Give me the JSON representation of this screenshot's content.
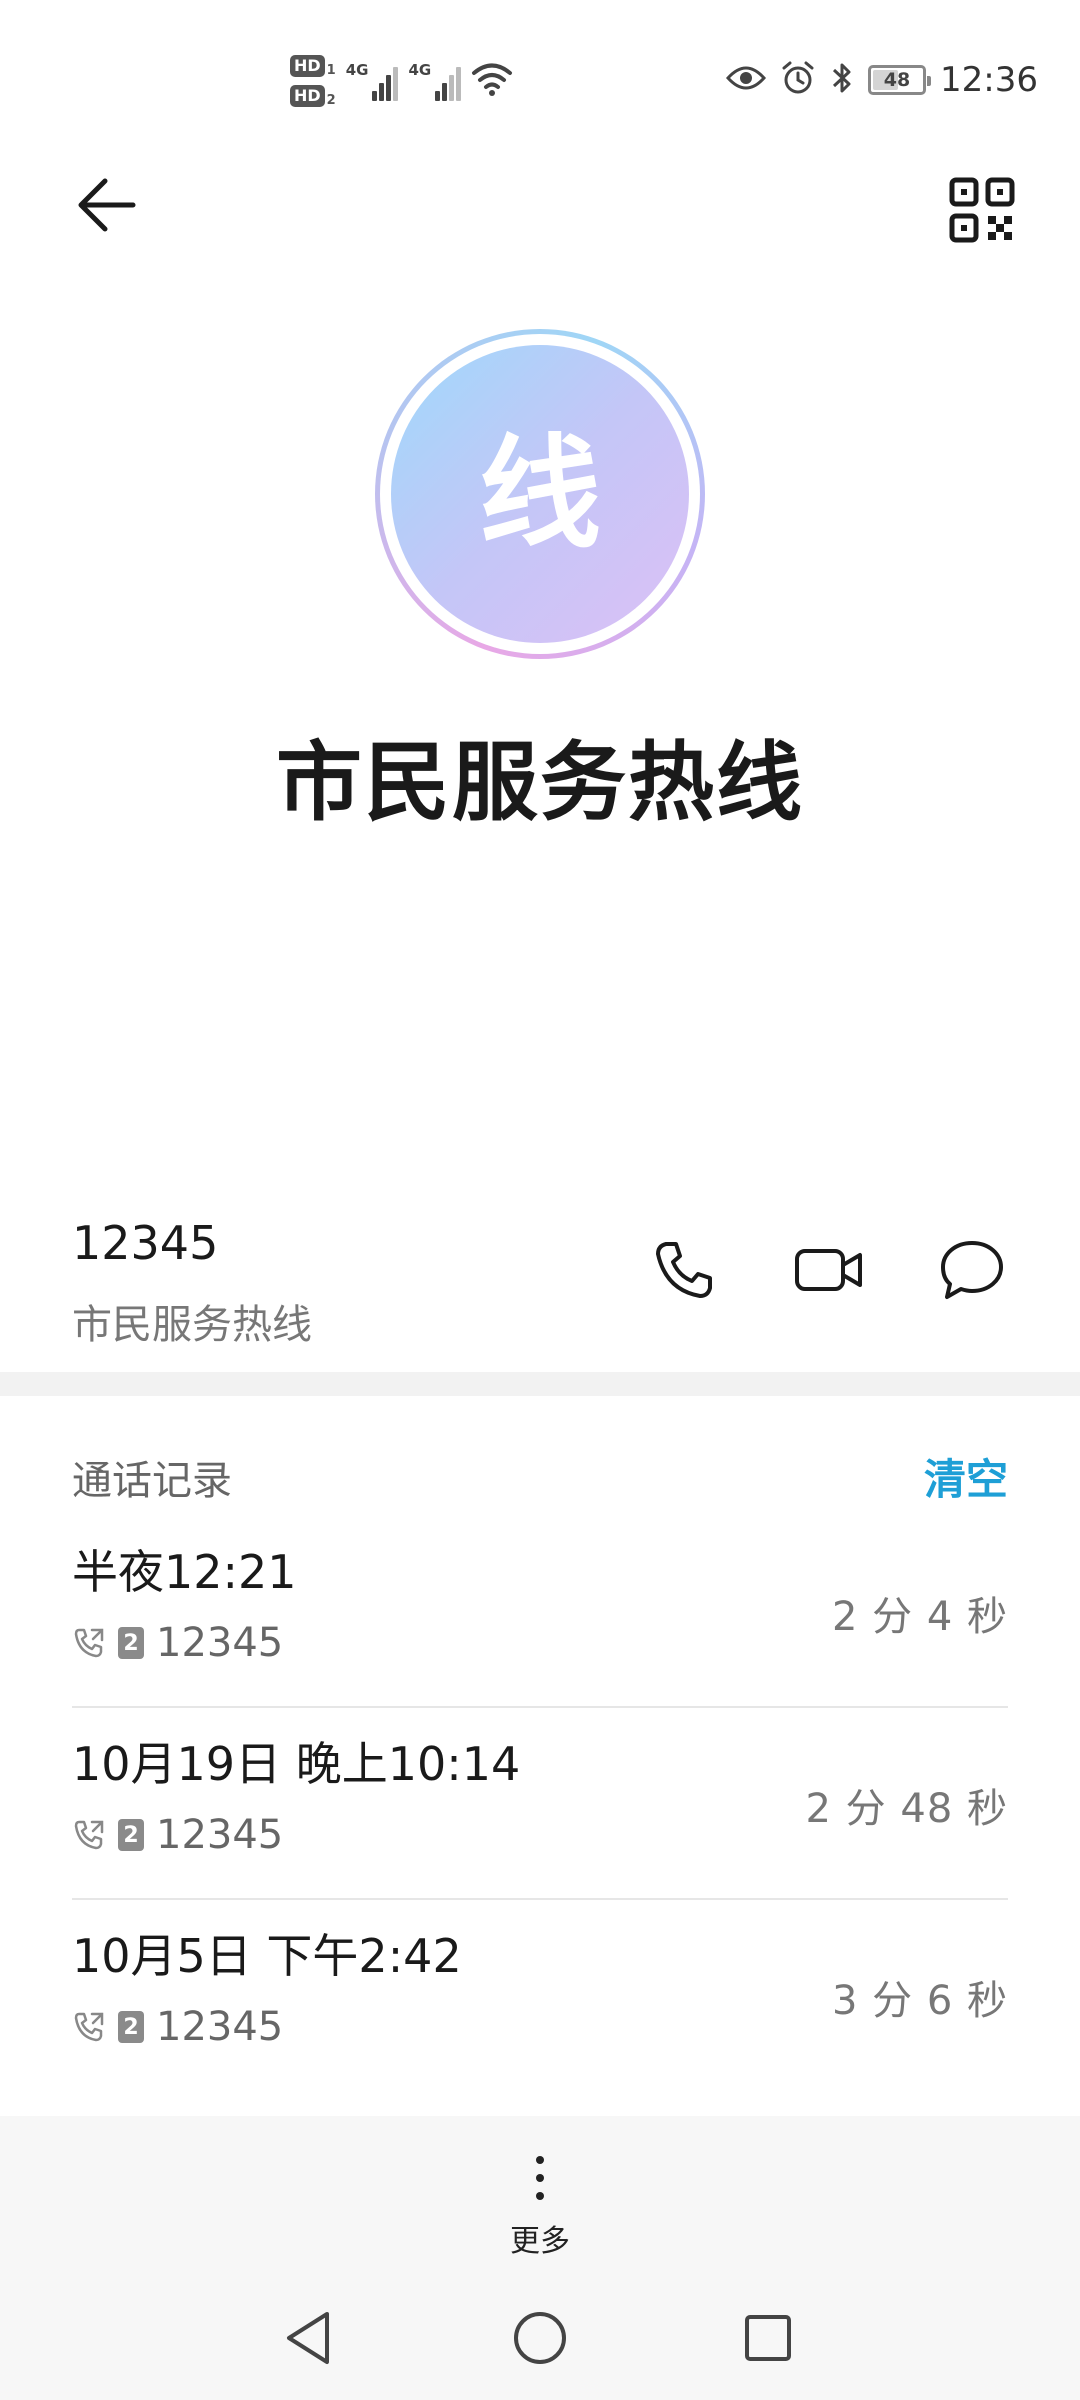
{
  "status_bar": {
    "hd1": "HD",
    "hd1_sub": "1",
    "hd2": "HD",
    "hd2_sub": "2",
    "network1": "4G",
    "network2": "4G",
    "battery_level": "48",
    "battery_fraction": 0.48,
    "time": "12:36",
    "icons": [
      "eye-icon",
      "alarm-icon",
      "bluetooth-icon",
      "wifi-icon"
    ]
  },
  "header": {
    "back_icon": "back-arrow-icon",
    "qr_icon": "qr-code-icon"
  },
  "contact": {
    "avatar_text": "线",
    "name": "市民服务热线",
    "number": "12345",
    "number_label": "市民服务热线",
    "actions": [
      "phone-icon",
      "video-call-icon",
      "message-icon"
    ]
  },
  "call_log": {
    "title": "通话记录",
    "clear_label": "清空",
    "entries": [
      {
        "time": "半夜12:21",
        "sim": "2",
        "number": "12345",
        "duration": "2 分 4 秒"
      },
      {
        "time": "10月19日 晚上10:14",
        "sim": "2",
        "number": "12345",
        "duration": "2 分 48 秒"
      },
      {
        "time": "10月5日 下午2:42",
        "sim": "2",
        "number": "12345",
        "duration": "3 分 6 秒"
      }
    ]
  },
  "bottom": {
    "more_label": "更多"
  },
  "colors": {
    "accent": "#1e9fd6",
    "avatar_gradient_start": "#9fd9fb",
    "avatar_gradient_end": "#dcc0f6"
  }
}
